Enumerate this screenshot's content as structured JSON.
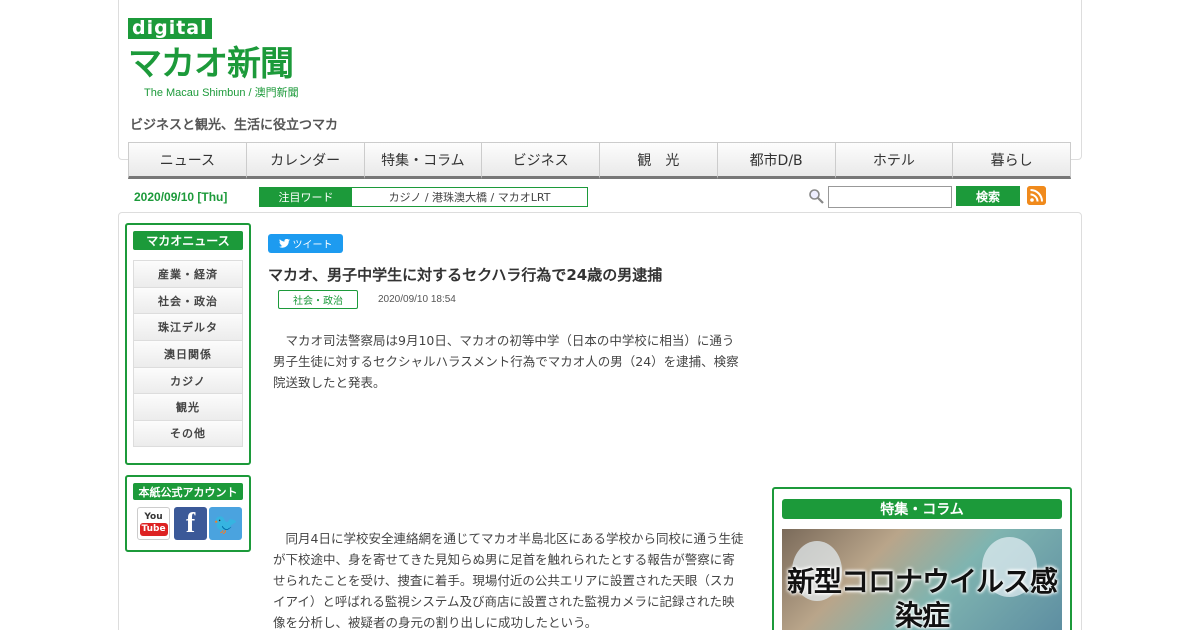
{
  "header": {
    "logo_digital": "digital",
    "logo_title": "マカオ新聞",
    "logo_sub": "The Macau Shimbun / 澳門新聞",
    "tagline": "ビジネスと観光、生活に役立つマカ"
  },
  "nav": {
    "items": [
      {
        "label": "ニュース"
      },
      {
        "label": "カレンダー"
      },
      {
        "label": "特集・コラム"
      },
      {
        "label": "ビジネス"
      },
      {
        "label": "観　光"
      },
      {
        "label": "都市D/B"
      },
      {
        "label": "ホテル"
      },
      {
        "label": "暮らし"
      }
    ]
  },
  "toolbar": {
    "date": "2020/09/10 [Thu]",
    "keyword_label": "注目ワード",
    "keywords": "カジノ / 港珠澳大橋 / マカオLRT",
    "search_placeholder": "",
    "search_button": "検索",
    "search_icon": "search-icon",
    "rss_icon": "rss-icon"
  },
  "sidebar": {
    "news_heading": "マカオニュース",
    "news_items": [
      {
        "label": "産業・経済"
      },
      {
        "label": "社会・政治"
      },
      {
        "label": "珠江デルタ"
      },
      {
        "label": "澳日関係"
      },
      {
        "label": "カジノ"
      },
      {
        "label": "観光"
      },
      {
        "label": "その他"
      }
    ],
    "account_heading": "本紙公式アカウント",
    "sns": {
      "youtube_top": "You",
      "youtube_bottom": "Tube",
      "facebook": "f",
      "twitter": "🐦"
    }
  },
  "article": {
    "tweet_label": "ツイート",
    "title": "マカオ、男子中学生に対するセクハラ行為で24歳の男逮捕",
    "category": "社会・政治",
    "timestamp": "2020/09/10 18:54",
    "paragraph1": "　マカオ司法警察局は9月10日、マカオの初等中学（日本の中学校に相当）に通う男子生徒に対するセクシャルハラスメント行為でマカオ人の男（24）を逮捕、検察院送致したと発表。",
    "paragraph2": "　同月4日に学校安全連絡網を通じてマカオ半島北区にある学校から同校に通う生徒が下校途中、身を寄せてきた見知らぬ男に足首を触れられたとする報告が警察に寄せられたことを受け、捜査に着手。現場付近の公共エリアに設置された天眼（スカイアイ）と呼ばれる監視システム及び商店に設置された監視カメラに記録された映像を分析し、被疑者の身元の割り出しに成功したという。"
  },
  "feature": {
    "heading": "特集・コラム",
    "image_text": "新型コロナウイルス感染症"
  },
  "colors": {
    "accent": "#1c9a3a",
    "rss": "#f08a1c",
    "twitter": "#1d9bf0",
    "facebook": "#3b5998"
  }
}
